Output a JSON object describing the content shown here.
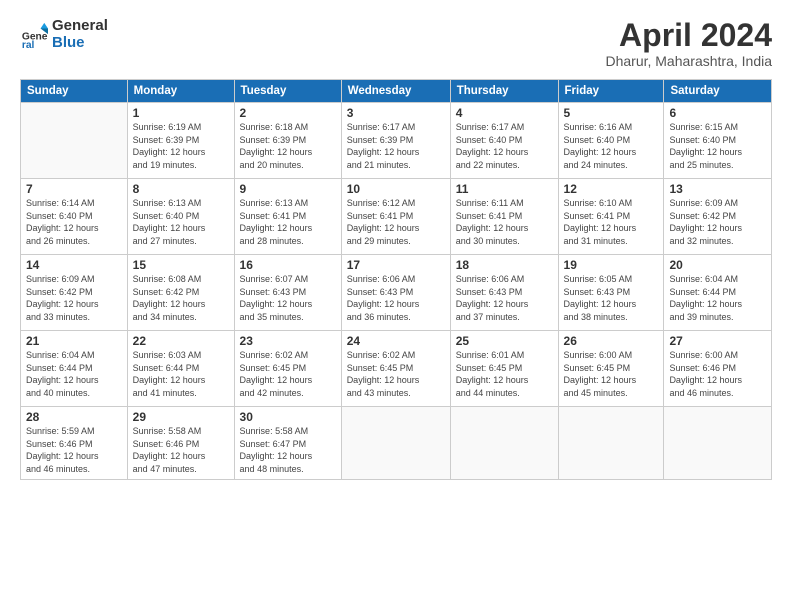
{
  "header": {
    "logo_general": "General",
    "logo_blue": "Blue",
    "title": "April 2024",
    "location": "Dharur, Maharashtra, India"
  },
  "weekdays": [
    "Sunday",
    "Monday",
    "Tuesday",
    "Wednesday",
    "Thursday",
    "Friday",
    "Saturday"
  ],
  "weeks": [
    [
      {
        "day": "",
        "info": ""
      },
      {
        "day": "1",
        "info": "Sunrise: 6:19 AM\nSunset: 6:39 PM\nDaylight: 12 hours\nand 19 minutes."
      },
      {
        "day": "2",
        "info": "Sunrise: 6:18 AM\nSunset: 6:39 PM\nDaylight: 12 hours\nand 20 minutes."
      },
      {
        "day": "3",
        "info": "Sunrise: 6:17 AM\nSunset: 6:39 PM\nDaylight: 12 hours\nand 21 minutes."
      },
      {
        "day": "4",
        "info": "Sunrise: 6:17 AM\nSunset: 6:40 PM\nDaylight: 12 hours\nand 22 minutes."
      },
      {
        "day": "5",
        "info": "Sunrise: 6:16 AM\nSunset: 6:40 PM\nDaylight: 12 hours\nand 24 minutes."
      },
      {
        "day": "6",
        "info": "Sunrise: 6:15 AM\nSunset: 6:40 PM\nDaylight: 12 hours\nand 25 minutes."
      }
    ],
    [
      {
        "day": "7",
        "info": "Sunrise: 6:14 AM\nSunset: 6:40 PM\nDaylight: 12 hours\nand 26 minutes."
      },
      {
        "day": "8",
        "info": "Sunrise: 6:13 AM\nSunset: 6:40 PM\nDaylight: 12 hours\nand 27 minutes."
      },
      {
        "day": "9",
        "info": "Sunrise: 6:13 AM\nSunset: 6:41 PM\nDaylight: 12 hours\nand 28 minutes."
      },
      {
        "day": "10",
        "info": "Sunrise: 6:12 AM\nSunset: 6:41 PM\nDaylight: 12 hours\nand 29 minutes."
      },
      {
        "day": "11",
        "info": "Sunrise: 6:11 AM\nSunset: 6:41 PM\nDaylight: 12 hours\nand 30 minutes."
      },
      {
        "day": "12",
        "info": "Sunrise: 6:10 AM\nSunset: 6:41 PM\nDaylight: 12 hours\nand 31 minutes."
      },
      {
        "day": "13",
        "info": "Sunrise: 6:09 AM\nSunset: 6:42 PM\nDaylight: 12 hours\nand 32 minutes."
      }
    ],
    [
      {
        "day": "14",
        "info": "Sunrise: 6:09 AM\nSunset: 6:42 PM\nDaylight: 12 hours\nand 33 minutes."
      },
      {
        "day": "15",
        "info": "Sunrise: 6:08 AM\nSunset: 6:42 PM\nDaylight: 12 hours\nand 34 minutes."
      },
      {
        "day": "16",
        "info": "Sunrise: 6:07 AM\nSunset: 6:43 PM\nDaylight: 12 hours\nand 35 minutes."
      },
      {
        "day": "17",
        "info": "Sunrise: 6:06 AM\nSunset: 6:43 PM\nDaylight: 12 hours\nand 36 minutes."
      },
      {
        "day": "18",
        "info": "Sunrise: 6:06 AM\nSunset: 6:43 PM\nDaylight: 12 hours\nand 37 minutes."
      },
      {
        "day": "19",
        "info": "Sunrise: 6:05 AM\nSunset: 6:43 PM\nDaylight: 12 hours\nand 38 minutes."
      },
      {
        "day": "20",
        "info": "Sunrise: 6:04 AM\nSunset: 6:44 PM\nDaylight: 12 hours\nand 39 minutes."
      }
    ],
    [
      {
        "day": "21",
        "info": "Sunrise: 6:04 AM\nSunset: 6:44 PM\nDaylight: 12 hours\nand 40 minutes."
      },
      {
        "day": "22",
        "info": "Sunrise: 6:03 AM\nSunset: 6:44 PM\nDaylight: 12 hours\nand 41 minutes."
      },
      {
        "day": "23",
        "info": "Sunrise: 6:02 AM\nSunset: 6:45 PM\nDaylight: 12 hours\nand 42 minutes."
      },
      {
        "day": "24",
        "info": "Sunrise: 6:02 AM\nSunset: 6:45 PM\nDaylight: 12 hours\nand 43 minutes."
      },
      {
        "day": "25",
        "info": "Sunrise: 6:01 AM\nSunset: 6:45 PM\nDaylight: 12 hours\nand 44 minutes."
      },
      {
        "day": "26",
        "info": "Sunrise: 6:00 AM\nSunset: 6:45 PM\nDaylight: 12 hours\nand 45 minutes."
      },
      {
        "day": "27",
        "info": "Sunrise: 6:00 AM\nSunset: 6:46 PM\nDaylight: 12 hours\nand 46 minutes."
      }
    ],
    [
      {
        "day": "28",
        "info": "Sunrise: 5:59 AM\nSunset: 6:46 PM\nDaylight: 12 hours\nand 46 minutes."
      },
      {
        "day": "29",
        "info": "Sunrise: 5:58 AM\nSunset: 6:46 PM\nDaylight: 12 hours\nand 47 minutes."
      },
      {
        "day": "30",
        "info": "Sunrise: 5:58 AM\nSunset: 6:47 PM\nDaylight: 12 hours\nand 48 minutes."
      },
      {
        "day": "",
        "info": ""
      },
      {
        "day": "",
        "info": ""
      },
      {
        "day": "",
        "info": ""
      },
      {
        "day": "",
        "info": ""
      }
    ]
  ]
}
